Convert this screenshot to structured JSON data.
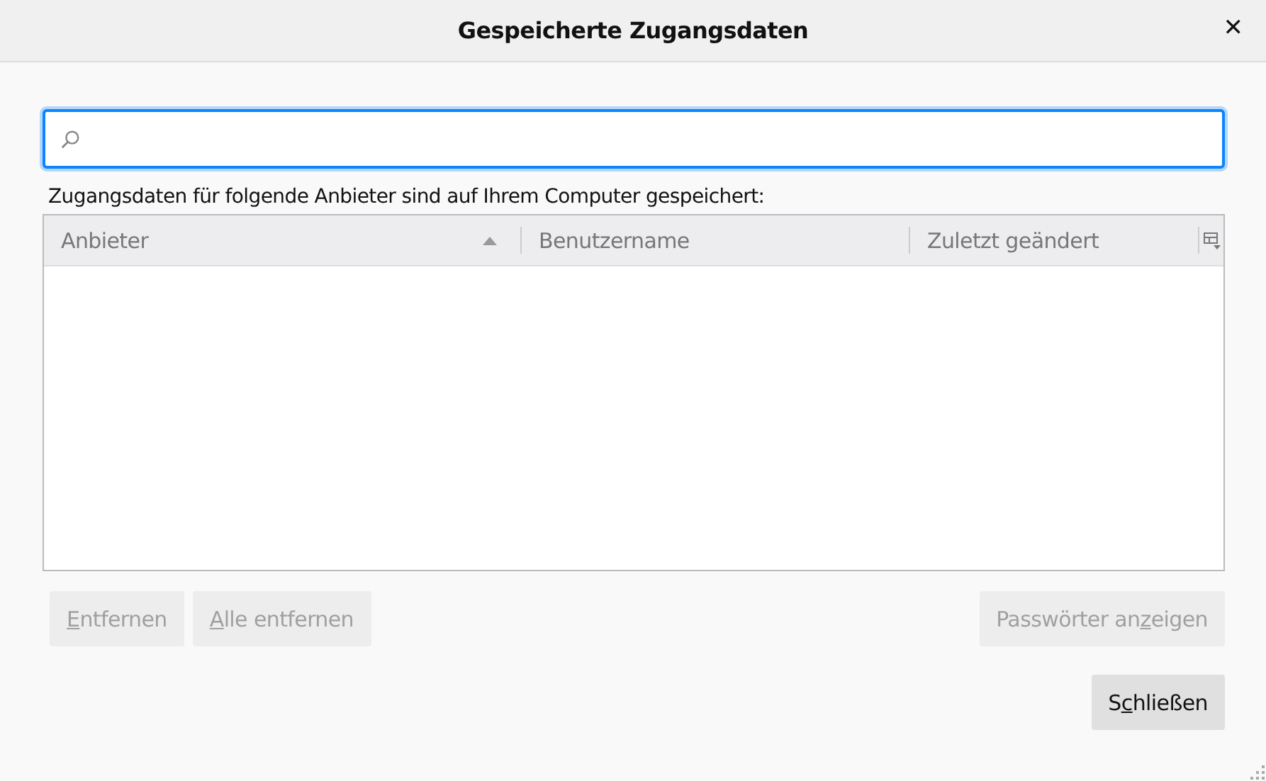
{
  "window": {
    "title": "Gespeicherte Zugangsdaten",
    "close": "✕"
  },
  "search": {
    "focused": true
  },
  "description": "Zugangsdaten für folgende Anbieter sind auf Ihrem Computer gespeichert:",
  "table": {
    "columns": [
      {
        "label": "Anbieter",
        "sorted_ascending": true
      },
      {
        "label": "Benutzername",
        "sorted_ascending": false
      },
      {
        "label": "Zuletzt geändert",
        "sorted_ascending": false
      }
    ]
  },
  "actions_left": [
    {
      "accesskey": "E",
      "label_after": "ntfernen",
      "disabled": true
    },
    {
      "accesskey": "A",
      "label_after": "lle entfernen",
      "disabled": true
    }
  ],
  "actions_right": [
    {
      "label_before": "Passwörter an",
      "accesskey": "z",
      "label_after": "eigen",
      "disabled": true
    }
  ],
  "footer_buttons": [
    {
      "label_before": "S",
      "accesskey": "c",
      "label_after": "hließen",
      "disabled": false
    }
  ]
}
